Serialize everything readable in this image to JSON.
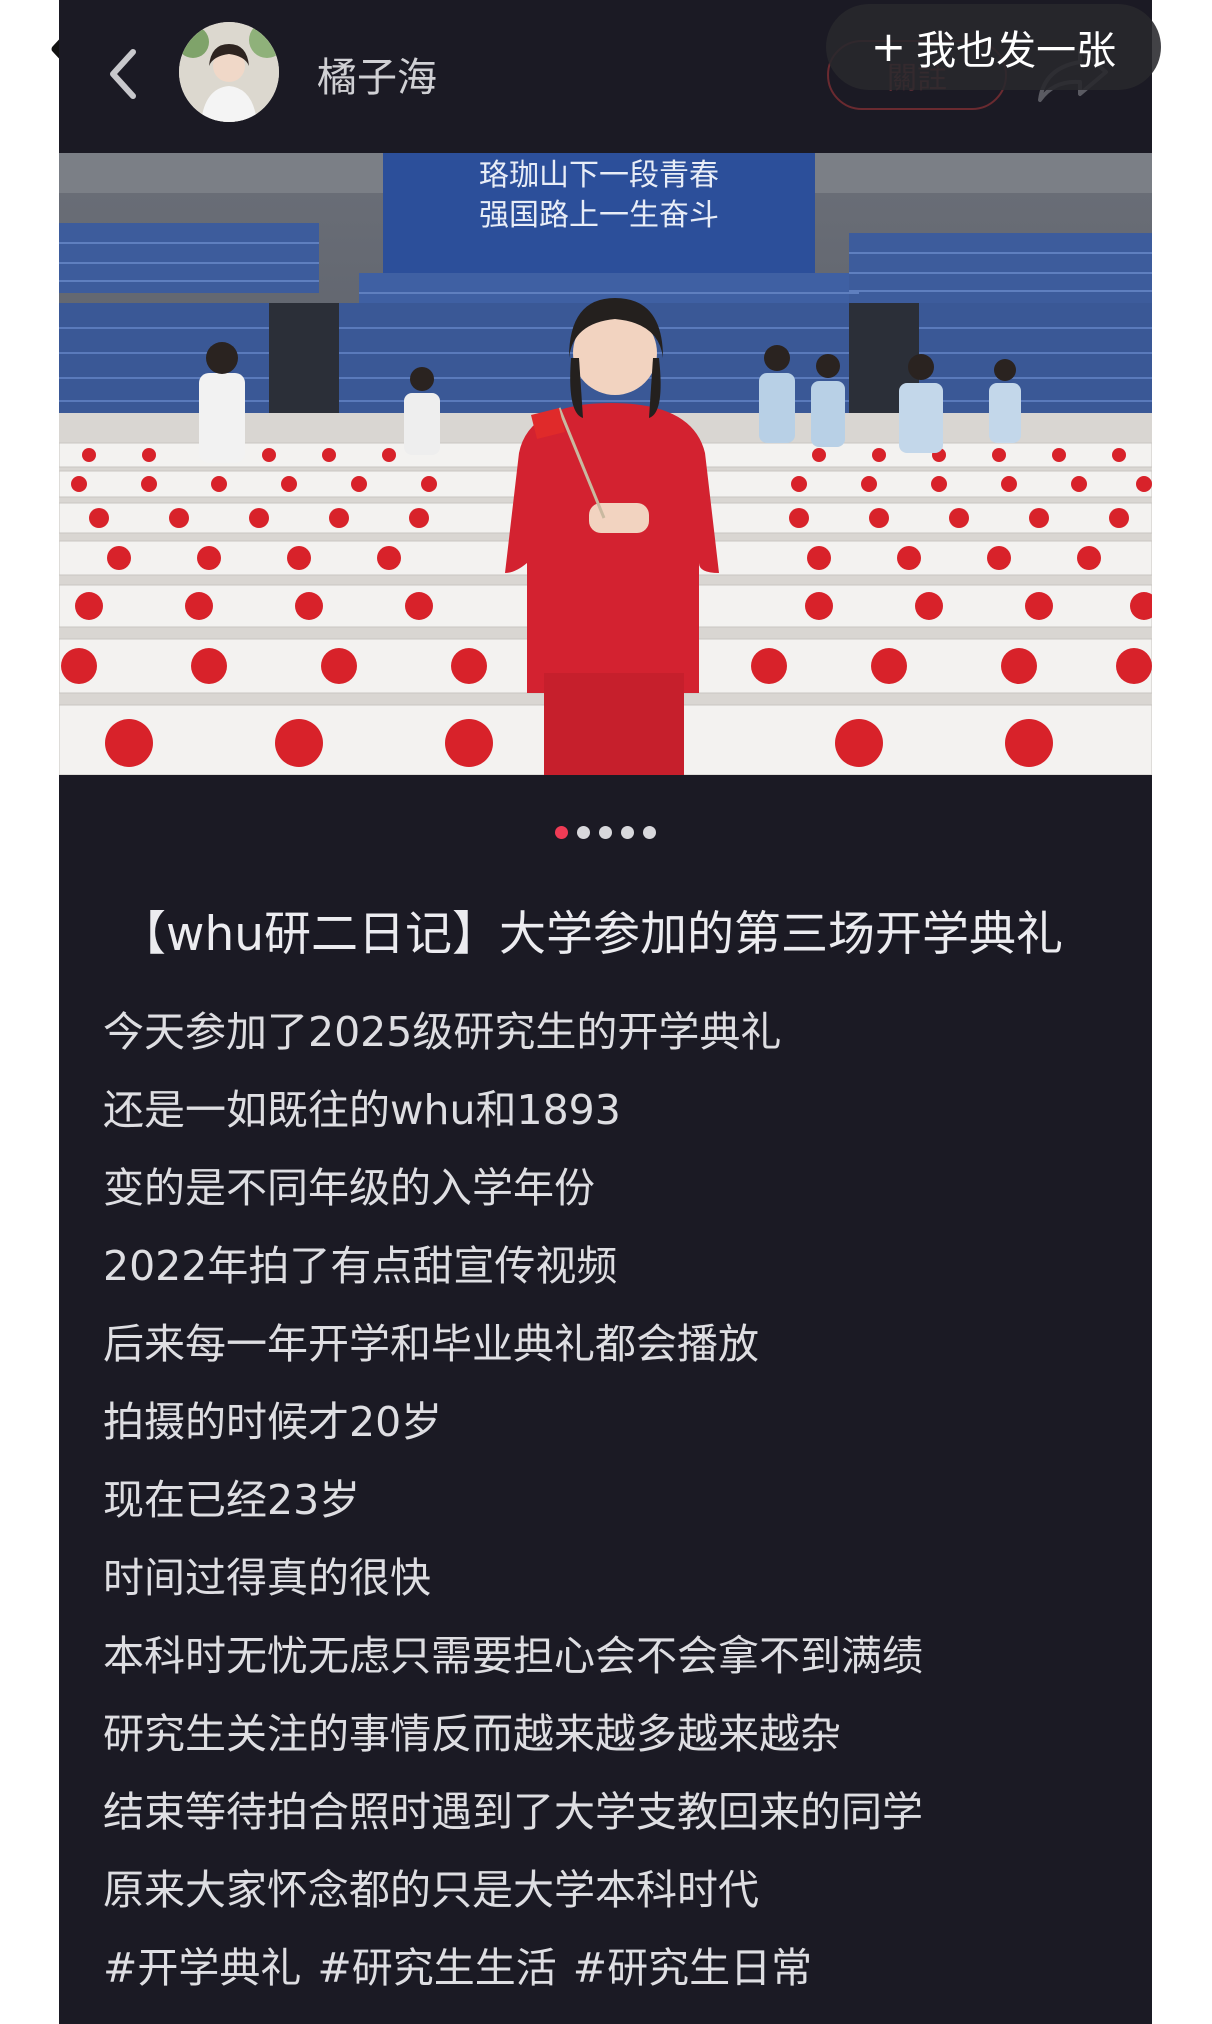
{
  "header": {
    "username": "橘子海",
    "follow_label": "關註",
    "overlay_label": "我也发一张"
  },
  "photo": {
    "banner_line1": "珞珈山下一段青春",
    "banner_line2": "强国路上一生奋斗",
    "current_index": 1,
    "total": 5
  },
  "post": {
    "title": "【whu研二日记】大学参加的第三场开学典礼",
    "lines": [
      "今天参加了2025级研究生的开学典礼",
      "还是一如既往的whu和1893",
      "变的是不同年级的入学年份",
      "2022年拍了有点甜宣传视频",
      "后来每一年开学和毕业典礼都会播放",
      "拍摄的时候才20岁",
      "现在已经23岁",
      "时间过得真的很快",
      "本科时无忧无虑只需要担心会不会拿不到满绩",
      "研究生关注的事情反而越来越多越来越杂",
      "结束等待拍合照时遇到了大学支教回来的同学",
      "原来大家怀念都的只是大学本科时代"
    ],
    "tags": [
      "#开学典礼",
      "#研究生生活",
      "#研究生日常"
    ]
  },
  "colors": {
    "background": "#1b1a24",
    "accent": "#ef3b55",
    "text": "#dedee2"
  },
  "icons": {
    "back": "chevron-left-icon",
    "share": "share-arrow-icon",
    "plus": "plus-icon"
  }
}
